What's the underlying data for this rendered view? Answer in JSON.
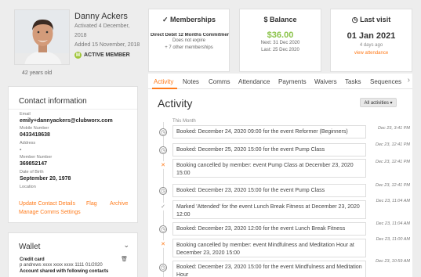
{
  "profile": {
    "name": "Danny Ackers",
    "activated": "Activated 4 December, 2018",
    "added": "Added 15 November, 2018",
    "badge_letter": "M",
    "badge_label": "ACTIVE MEMBER",
    "age": "42 years old"
  },
  "memberships": {
    "icon": "check-icon",
    "title": "Memberships",
    "plan": "Direct Debit 12 Months Commitment",
    "expiry": "Does not expire",
    "others": "+ 7 other memberships"
  },
  "balance": {
    "icon": "dollar-icon",
    "title": "Balance",
    "amount": "$36.00",
    "next": "Next: 31 Dec 2020",
    "last": "Last: 25 Dec 2020",
    "amount_color": "#8bc34a"
  },
  "last_visit": {
    "icon": "clock-icon",
    "title": "Last visit",
    "date": "01 Jan 2021",
    "ago": "4 days ago",
    "link": "view attendance"
  },
  "contact": {
    "title": "Contact information",
    "fields": [
      {
        "label": "Email",
        "value": "emily+dannyackers@clubworx.com"
      },
      {
        "label": "Mobile Number",
        "value": "0433418638"
      },
      {
        "label": "Address",
        "value": "-"
      },
      {
        "label": "Member Number",
        "value": "369852147"
      },
      {
        "label": "Date of Birth",
        "value": "September 20, 1978"
      },
      {
        "label": "Location",
        "value": ""
      }
    ],
    "links": [
      "Update Contact Details",
      "Flag",
      "Archive",
      "Manage Comms Settings"
    ]
  },
  "wallet": {
    "title": "Wallet",
    "card_label": "Credit card",
    "card_detail": "p andrews   xxxx xxxx xxxx 1111   01/2020",
    "shared": "Account shared with following contacts"
  },
  "tabs": [
    "Activity",
    "Notes",
    "Comms",
    "Attendance",
    "Payments",
    "Waivers",
    "Tasks",
    "Sequences"
  ],
  "activity": {
    "title": "Activity",
    "filter": "All activities ▾",
    "month": "This Month",
    "items": [
      {
        "type": "clock",
        "text": "Booked: December 24, 2020 09:00 for the event Reformer (Beginners)",
        "time": "Dec 23, 3:41 PM"
      },
      {
        "type": "clock",
        "text": "Booked: December 25, 2020 15:00 for the event Pump Class",
        "time": "Dec 23, 12:41 PM"
      },
      {
        "type": "cancel",
        "text": "Booking cancelled by member: event Pump Class at December 23, 2020 15:00",
        "time": "Dec 23, 12:41 PM"
      },
      {
        "type": "clock",
        "text": "Booked: December 23, 2020 15:00 for the event Pump Class",
        "time": "Dec 23, 12:41 PM"
      },
      {
        "type": "check",
        "text": "Marked 'Attended' for the event Lunch Break Fitness at December 23, 2020 12:00",
        "time": "Dec 23, 11:04 AM"
      },
      {
        "type": "clock",
        "text": "Booked: December 23, 2020 12:00 for the event Lunch Break Fitness",
        "time": "Dec 23, 11:04 AM"
      },
      {
        "type": "cancel",
        "text": "Booking cancelled by member: event Mindfulness and Meditation Hour at December 23, 2020 15:00",
        "time": "Dec 23, 11:00 AM"
      },
      {
        "type": "clock",
        "text": "Booked: December 23, 2020 15:00 for the event Mindfulness and Meditation Hour",
        "time": "Dec 23, 10:59 AM"
      }
    ]
  },
  "accent_color": "#ff7b1b"
}
